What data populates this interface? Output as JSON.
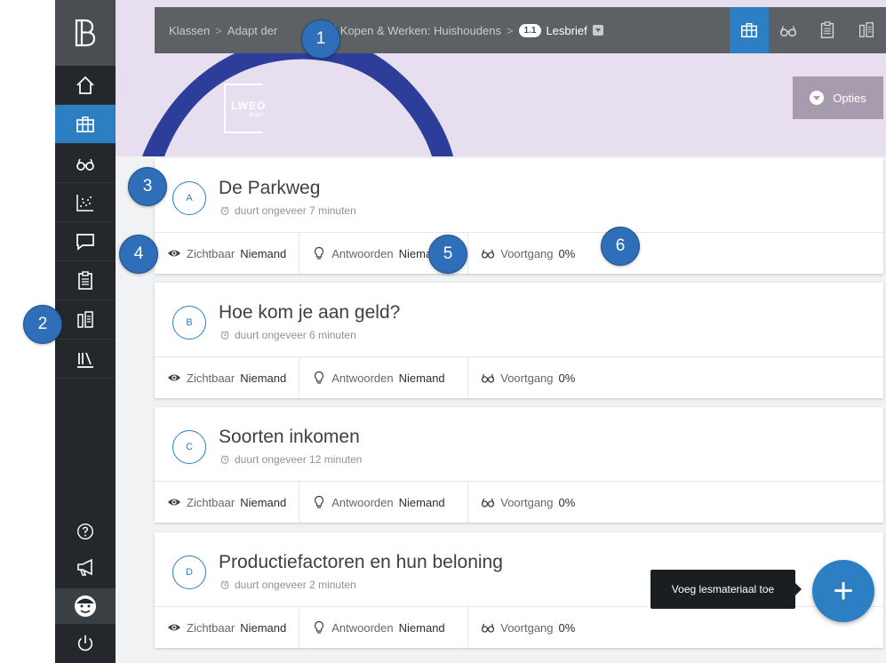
{
  "colors": {
    "sidebar": "#24282c",
    "accent": "#2b7fc2",
    "crumbbar": "#5d6165",
    "hero": "#e7dff0",
    "opties": "#a79cae",
    "callout": "#2f6fba"
  },
  "sidebar": {
    "logo_icon": "brand-b-logo-icon",
    "items": [
      {
        "name": "home",
        "icon": "home-icon"
      },
      {
        "name": "lessons",
        "icon": "briefcase-icon",
        "active": true
      },
      {
        "name": "view",
        "icon": "glasses-icon"
      },
      {
        "name": "results",
        "icon": "scatter-chart-icon"
      },
      {
        "name": "messages",
        "icon": "speech-bubble-icon"
      },
      {
        "name": "tasks",
        "icon": "clipboard-icon"
      },
      {
        "name": "planning",
        "icon": "columns-icon"
      },
      {
        "name": "library",
        "icon": "library-icon"
      }
    ],
    "bottom": [
      {
        "name": "help",
        "icon": "help-circle-icon"
      },
      {
        "name": "announcements",
        "icon": "megaphone-icon"
      },
      {
        "name": "profile",
        "icon": "avatar-icon"
      },
      {
        "name": "logout",
        "icon": "power-icon"
      }
    ]
  },
  "breadcrumb": {
    "items": [
      {
        "text": "Klassen"
      },
      {
        "text": "Adapt der"
      },
      {
        "badge": "1",
        "text": "Kopen & Werken: Huishoudens"
      },
      {
        "badge": "1.1",
        "text": "Lesbrief",
        "current": true
      }
    ],
    "separator": ">"
  },
  "toolbar": {
    "buttons": [
      "briefcase-icon",
      "glasses-icon",
      "clipboard-icon",
      "columns-icon"
    ],
    "active": 0
  },
  "hero": {
    "logo_text": "LWEO",
    "logo_sub": "ADAPT"
  },
  "opties": {
    "label": "Opties"
  },
  "labels": {
    "zichtbaar": "Zichtbaar",
    "antwoorden": "Antwoorden",
    "voortgang": "Voortgang"
  },
  "cards": [
    {
      "letter": "A",
      "title": "De Parkweg",
      "duration": "duurt ongeveer 7 minuten",
      "zichtbaar": "Niemand",
      "antwoorden": "Niemand",
      "voortgang": "0%"
    },
    {
      "letter": "B",
      "title": "Hoe kom je aan geld?",
      "duration": "duurt ongeveer 6 minuten",
      "zichtbaar": "Niemand",
      "antwoorden": "Niemand",
      "voortgang": "0%"
    },
    {
      "letter": "C",
      "title": "Soorten inkomen",
      "duration": "duurt ongeveer 12 minuten",
      "zichtbaar": "Niemand",
      "antwoorden": "Niemand",
      "voortgang": "0%"
    },
    {
      "letter": "D",
      "title": "Productiefactoren en hun beloning",
      "duration": "duurt ongeveer 2 minuten",
      "zichtbaar": "Niemand",
      "antwoorden": "Niemand",
      "voortgang": "0%"
    }
  ],
  "callouts": [
    "1",
    "2",
    "3",
    "4",
    "5",
    "6"
  ],
  "tooltip": "Voeg lesmateriaal toe",
  "fab": {
    "label": "+"
  }
}
